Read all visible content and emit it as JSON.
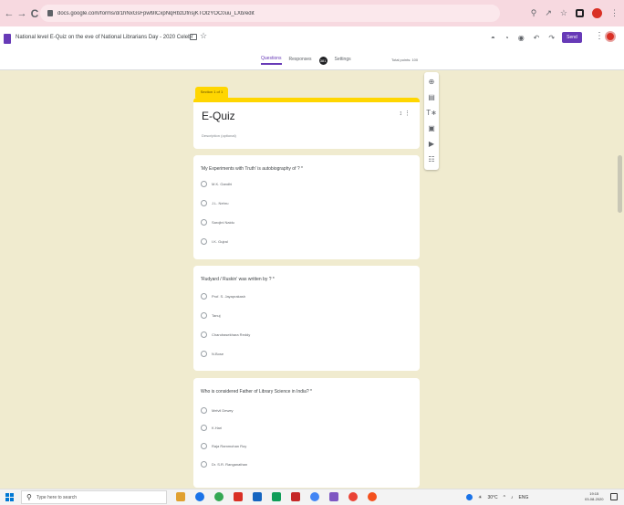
{
  "browser": {
    "url": "docs.google.com/forms/d/1hNxGsFpwl9ICxpNqRbzDfnsjKTOlzYOC0uu_LXb/edit",
    "nav_back": "←",
    "nav_forward": "→",
    "reload": "C"
  },
  "forms_header": {
    "doc_title": "National level E-Quiz on the eve of National Librarians Day - 2020 Celebr",
    "send_label": "Send",
    "tabs": [
      {
        "label": "Questions",
        "active": true
      },
      {
        "label": "Responses",
        "active": false
      },
      {
        "label": "Settings",
        "active": false
      }
    ],
    "responses_badge": "381",
    "total_points": "Total points: 100"
  },
  "section": {
    "tag": "Section 1 of 1"
  },
  "quiz": {
    "title": "E-Quiz",
    "description": "Description (optional)"
  },
  "questions": [
    {
      "text": "'My Experiments with Truth' is autobiography of ? *",
      "options": [
        "M.K. Gandhi",
        "J.L. Nehru",
        "Sarojini Naidu",
        "I.K. Gujral"
      ]
    },
    {
      "text": "'Rudyard / Ruskin' was written by ? *",
      "options": [
        "Prof. S. Jayaprakash",
        "Tanuj",
        "Chandrasekhara Reddy",
        "N.Bose"
      ]
    },
    {
      "text": "Who is considered Father of Library Science in India? *",
      "options": [
        "Melvil Dewey",
        "K.Hari",
        "Raja Rammohan Roy",
        "Dr. S.R. Ranganathan"
      ]
    }
  ],
  "taskbar": {
    "search_placeholder": "Type here to search",
    "weather": "30°C",
    "language": "ENG",
    "time": "19:15",
    "date": "03-08-2020"
  },
  "colors": {
    "accent": "#673ab7",
    "section_yellow": "#ffd600",
    "background": "#f0ebcf"
  }
}
